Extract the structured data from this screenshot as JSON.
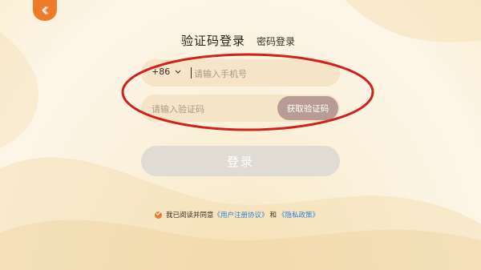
{
  "header": {
    "back_icon": "chevron-left-icon",
    "tab_active": "验证码登录",
    "tab_inactive": "密码登录"
  },
  "phone": {
    "country_code": "+86",
    "placeholder": "请输入手机号"
  },
  "code": {
    "placeholder": "请输入验证码",
    "get_code_label": "获取验证码"
  },
  "login": {
    "label": "登录"
  },
  "agreement": {
    "prefix": "我已阅读并同意",
    "user_agreement": "《用户注册协议》",
    "and": "和",
    "privacy_policy": "《隐私政策》",
    "checked": true
  },
  "colors": {
    "accent": "#f07a2c",
    "annotation_red": "#d0211b",
    "link": "#2f7fd6",
    "get_code_bg": "#b89b95",
    "login_disabled_bg": "#e0dcd3"
  }
}
